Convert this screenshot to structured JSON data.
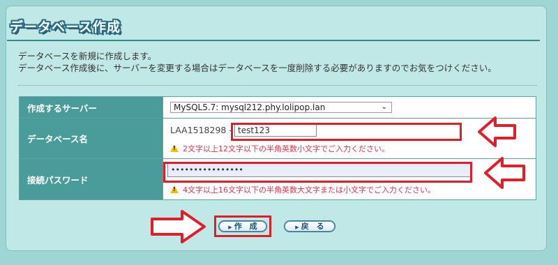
{
  "page": {
    "title": "データベース作成",
    "description_lines": [
      "データベースを新規に作成します。",
      "データベース作成後に、サーバーを変更する場合はデータベースを一度削除する必要がありますのでお気をつけください。"
    ]
  },
  "form": {
    "server": {
      "label": "作成するサーバー",
      "selected": "MySQL5.7: mysql212.phy.lolipop.lan"
    },
    "database_name": {
      "label": "データベース名",
      "prefix": "LAA1518298 -",
      "value": "test123",
      "note": "2文字以上12文字以下の半角英数小文字でご入力ください。"
    },
    "password": {
      "label": "接続パスワード",
      "value": "••••••••••••••••",
      "note": "4文字以上16文字以下の半角英数大文字または小文字でご入力ください。"
    }
  },
  "buttons": {
    "create": "作　成",
    "back": "戻　る"
  },
  "colors": {
    "background": "#9fd6d5",
    "panel": "#c0e8e6",
    "label_cell": "#4a9c9b",
    "highlight": "#e21d2a",
    "error_text": "#e0304a"
  }
}
